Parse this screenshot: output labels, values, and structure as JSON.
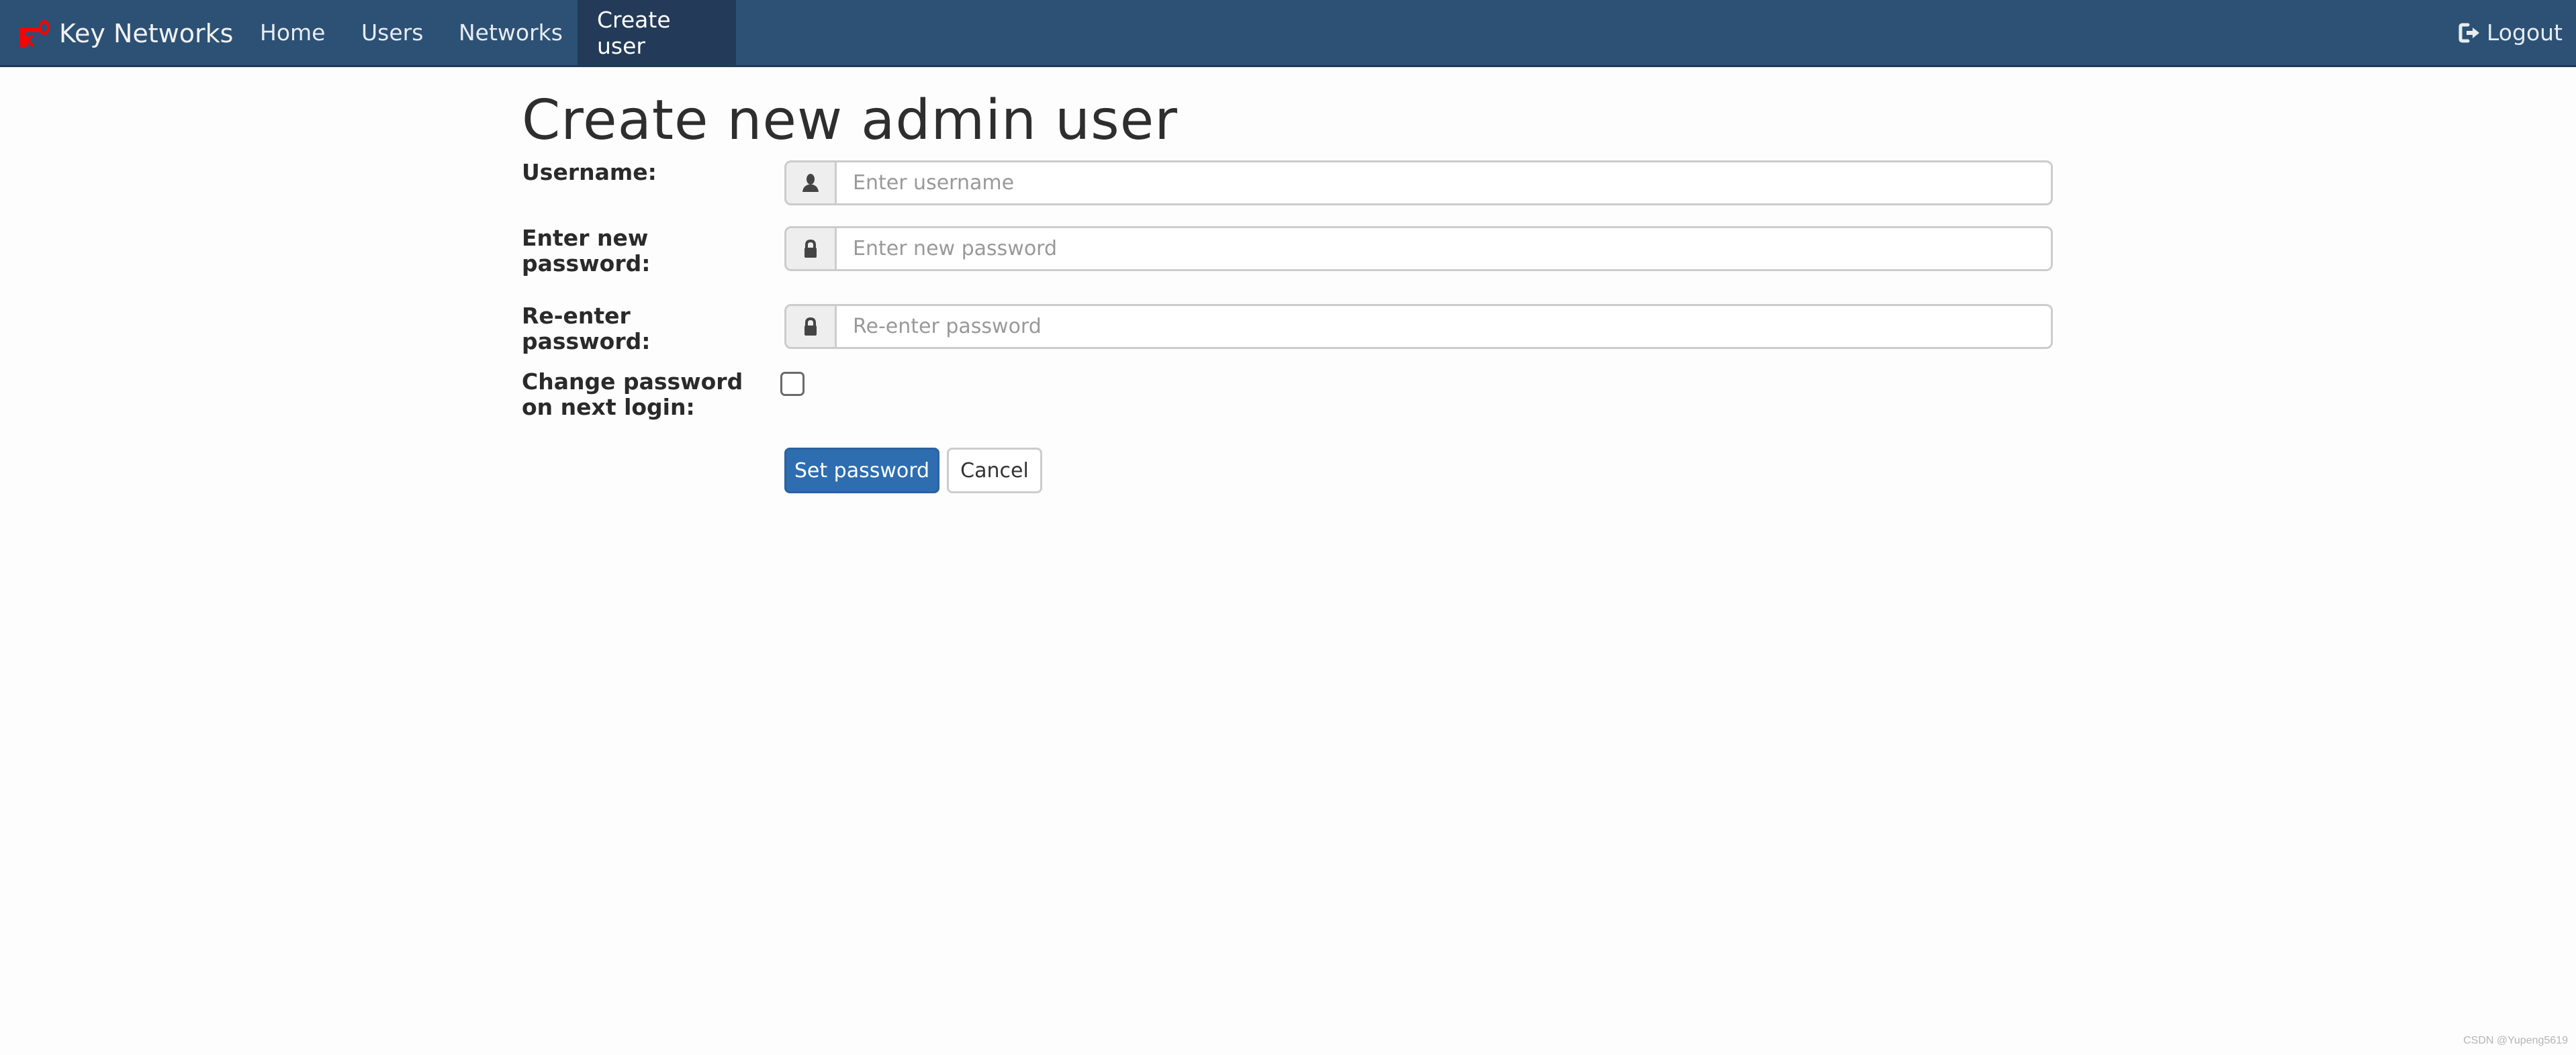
{
  "navbar": {
    "brand": {
      "label": "Key Networks",
      "icon": "key-logo-icon",
      "color": "#ff0000"
    },
    "items": [
      {
        "label": "Home",
        "active": false
      },
      {
        "label": "Users",
        "active": false
      },
      {
        "label": "Networks",
        "active": false
      },
      {
        "label": "Create user",
        "active": true
      }
    ],
    "logout": {
      "label": "Logout",
      "icon": "logout-icon"
    },
    "background_color": "#2c5175",
    "active_color": "#233b58"
  },
  "page": {
    "title": "Create new admin user"
  },
  "form": {
    "username": {
      "label": "Username:",
      "placeholder": "Enter username",
      "value": "",
      "icon": "user-icon"
    },
    "new_password": {
      "label_line1": "Enter new",
      "label_line2": "password:",
      "placeholder": "Enter new password",
      "value": "",
      "icon": "lock-icon"
    },
    "reenter_password": {
      "label": "Re-enter password:",
      "placeholder": "Re-enter password",
      "value": "",
      "icon": "lock-icon"
    },
    "change_password": {
      "label_line1": "Change password",
      "label_line2": "on next login:",
      "checked": false
    },
    "submit_label": "Set password",
    "cancel_label": "Cancel",
    "primary_color": "#2e6db0"
  },
  "watermark": "CSDN @Yupeng5619"
}
